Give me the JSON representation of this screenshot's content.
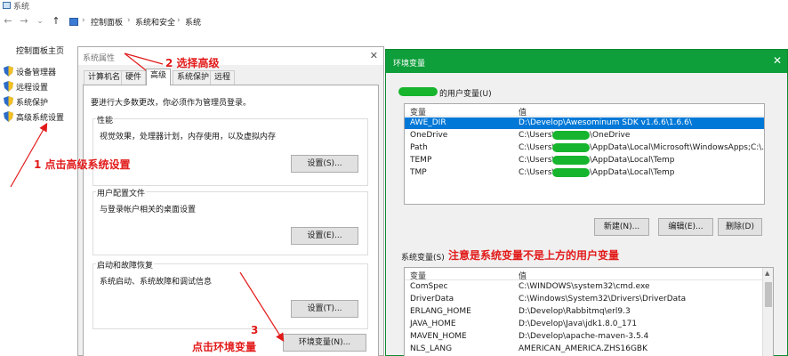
{
  "control_panel": {
    "title": "系统",
    "back_icon": "←",
    "forward_icon": "→",
    "down_icon": "⌄",
    "up_icon": "↑",
    "breadcrumbs": [
      "控制面板",
      "系统和安全",
      "系统"
    ],
    "crumb_sep": "›",
    "sidebar_home": "控制面板主页",
    "sidebar_items": [
      "设备管理器",
      "远程设置",
      "系统保护",
      "高级系统设置"
    ]
  },
  "system_properties": {
    "title": "系统属性",
    "close": "✕",
    "tabs": [
      "计算机名",
      "硬件",
      "高级",
      "系统保护",
      "远程"
    ],
    "active_tab": "高级",
    "admin_note": "要进行大多数更改，你必须作为管理员登录。",
    "performance": {
      "label": "性能",
      "desc": "视觉效果，处理器计划，内存使用，以及虚拟内存",
      "button": "设置(S)..."
    },
    "user_profiles": {
      "label": "用户配置文件",
      "desc": "与登录帐户相关的桌面设置",
      "button": "设置(E)..."
    },
    "startup_recovery": {
      "label": "启动和故障恢复",
      "desc": "系统启动、系统故障和调试信息",
      "button": "设置(T)..."
    },
    "env_button": "环境变量(N)..."
  },
  "environment_variables": {
    "title": "环境变量",
    "close": "✕",
    "user_section_suffix": "的用户变量(U)",
    "columns": [
      "变量",
      "值"
    ],
    "user_vars": [
      {
        "name": "AWE_DIR",
        "value": "D:\\Develop\\Awesominum SDK v1.6.6\\1.6.6\\"
      },
      {
        "name": "OneDrive",
        "value": "C:\\Users\\",
        "value_tail": "\\OneDrive"
      },
      {
        "name": "Path",
        "value": "C:\\Users\\",
        "value_tail": "\\AppData\\Local\\Microsoft\\WindowsApps;C:\\..."
      },
      {
        "name": "TEMP",
        "value": "C:\\Users\\",
        "value_tail": "\\AppData\\Local\\Temp"
      },
      {
        "name": "TMP",
        "value": "C:\\Users\\",
        "value_tail": "\\AppData\\Local\\Temp"
      }
    ],
    "user_buttons": [
      "新建(N)...",
      "编辑(E)...",
      "删除(D)"
    ],
    "system_section": "系统变量(S)",
    "system_vars": [
      {
        "name": "ComSpec",
        "value": "C:\\WINDOWS\\system32\\cmd.exe"
      },
      {
        "name": "DriverData",
        "value": "C:\\Windows\\System32\\Drivers\\DriverData"
      },
      {
        "name": "ERLANG_HOME",
        "value": "D:\\Develop\\Rabbitmq\\erl9.3"
      },
      {
        "name": "JAVA_HOME",
        "value": "D:\\Develop\\Java\\jdk1.8.0_171"
      },
      {
        "name": "MAVEN_HOME",
        "value": "D:\\Develop\\apache-maven-3.5.4"
      },
      {
        "name": "NLS_LANG",
        "value": "AMERICAN_AMERICA.ZHS16GBK"
      }
    ],
    "scroll_up": "▲"
  },
  "annotations": {
    "step1": "1 点击高级系统设置",
    "step2": "2  选择高级",
    "step3_num": "3",
    "step3": "点击环境变量",
    "system_note": "注意是系统变量不是上方的用户变量"
  },
  "colors": {
    "accent_red": "#e21a1a",
    "title_green": "#0e9e3a",
    "blob_green": "#17b42d",
    "selection": "#0078d7"
  }
}
